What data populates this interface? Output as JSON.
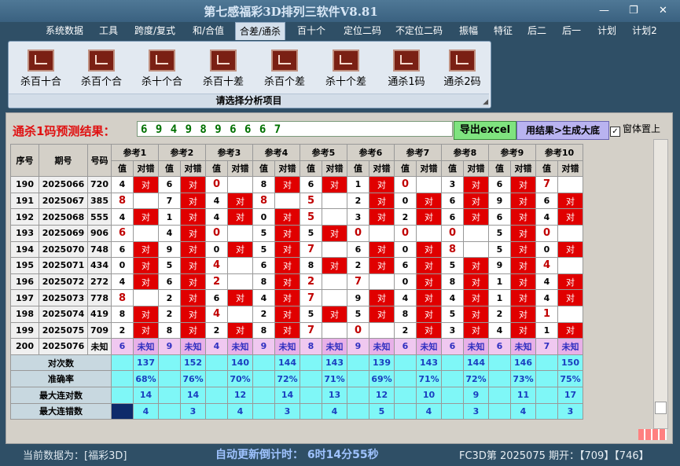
{
  "window": {
    "title": "第七感福彩3D排列三软件V8.81",
    "minimize": "—",
    "restore": "❐",
    "close": "✕"
  },
  "menu": [
    "系统数据",
    "工具",
    "跨度/复式",
    "和/合值",
    "合差/通杀",
    "百十个",
    "定位二码",
    "不定位二码",
    "振幅",
    "特征",
    "后二",
    "后一",
    "计划",
    "计划2"
  ],
  "menu_active": "合差/通杀",
  "ribbon": {
    "buttons": [
      {
        "label": "杀百十合",
        "icon": "chart-icon"
      },
      {
        "label": "杀百个合",
        "icon": "chart-icon"
      },
      {
        "label": "杀十个合",
        "icon": "chart-icon"
      },
      {
        "label": "杀百十差",
        "icon": "chart-icon"
      },
      {
        "label": "杀百个差",
        "icon": "chart-icon"
      },
      {
        "label": "杀十个差",
        "icon": "chart-icon"
      },
      {
        "label": "通杀1码",
        "icon": "chart-icon"
      },
      {
        "label": "通杀2码",
        "icon": "chart-icon"
      }
    ],
    "caption": "请选择分析项目"
  },
  "prediction": {
    "label": "通杀1码预测结果：",
    "value": "6 9 4 9 8 9 6 6 6 7",
    "export_label": "导出excel",
    "generate_label": "用结果>生成大底",
    "topmost_label": "窗体置上",
    "topmost_checked": "✓"
  },
  "table": {
    "h_seq": "序号",
    "h_period": "期号",
    "h_code": "号码",
    "refs": [
      "参考1",
      "参考2",
      "参考3",
      "参考4",
      "参考5",
      "参考6",
      "参考7",
      "参考8",
      "参考9",
      "参考10"
    ],
    "sub_val": "值",
    "sub_res": "对错",
    "hit_text": "对",
    "rows": [
      {
        "seq": "190",
        "period": "2025066",
        "code": "720",
        "cells": [
          [
            "4",
            1
          ],
          [
            "6",
            1
          ],
          [
            "0",
            0
          ],
          [
            "8",
            1
          ],
          [
            "6",
            1
          ],
          [
            "1",
            1
          ],
          [
            "0",
            0
          ],
          [
            "3",
            1
          ],
          [
            "6",
            1
          ],
          [
            "7",
            0
          ]
        ]
      },
      {
        "seq": "191",
        "period": "2025067",
        "code": "385",
        "cells": [
          [
            "8",
            0
          ],
          [
            "7",
            1
          ],
          [
            "4",
            1
          ],
          [
            "8",
            0
          ],
          [
            "5",
            0
          ],
          [
            "2",
            1
          ],
          [
            "0",
            1
          ],
          [
            "6",
            1
          ],
          [
            "9",
            1
          ],
          [
            "6",
            1
          ]
        ]
      },
      {
        "seq": "192",
        "period": "2025068",
        "code": "555",
        "cells": [
          [
            "4",
            1
          ],
          [
            "1",
            1
          ],
          [
            "4",
            1
          ],
          [
            "0",
            1
          ],
          [
            "5",
            0
          ],
          [
            "3",
            1
          ],
          [
            "2",
            1
          ],
          [
            "6",
            1
          ],
          [
            "6",
            1
          ],
          [
            "4",
            1
          ]
        ]
      },
      {
        "seq": "193",
        "period": "2025069",
        "code": "906",
        "cells": [
          [
            "6",
            0
          ],
          [
            "4",
            1
          ],
          [
            "0",
            0
          ],
          [
            "5",
            1
          ],
          [
            "5",
            1
          ],
          [
            "0",
            0
          ],
          [
            "0",
            0
          ],
          [
            "0",
            0
          ],
          [
            "5",
            1
          ],
          [
            "0",
            0
          ]
        ]
      },
      {
        "seq": "194",
        "period": "2025070",
        "code": "748",
        "cells": [
          [
            "6",
            1
          ],
          [
            "9",
            1
          ],
          [
            "0",
            1
          ],
          [
            "5",
            1
          ],
          [
            "7",
            0
          ],
          [
            "6",
            1
          ],
          [
            "0",
            1
          ],
          [
            "8",
            0
          ],
          [
            "5",
            1
          ],
          [
            "0",
            1
          ]
        ]
      },
      {
        "seq": "195",
        "period": "2025071",
        "code": "434",
        "cells": [
          [
            "0",
            1
          ],
          [
            "5",
            1
          ],
          [
            "4",
            0
          ],
          [
            "6",
            1
          ],
          [
            "8",
            1
          ],
          [
            "2",
            1
          ],
          [
            "6",
            1
          ],
          [
            "5",
            1
          ],
          [
            "9",
            1
          ],
          [
            "4",
            0
          ]
        ]
      },
      {
        "seq": "196",
        "period": "2025072",
        "code": "272",
        "cells": [
          [
            "4",
            1
          ],
          [
            "6",
            1
          ],
          [
            "2",
            0
          ],
          [
            "8",
            1
          ],
          [
            "2",
            0
          ],
          [
            "7",
            0
          ],
          [
            "0",
            1
          ],
          [
            "8",
            1
          ],
          [
            "1",
            1
          ],
          [
            "4",
            1
          ]
        ]
      },
      {
        "seq": "197",
        "period": "2025073",
        "code": "778",
        "cells": [
          [
            "8",
            0
          ],
          [
            "2",
            1
          ],
          [
            "6",
            1
          ],
          [
            "4",
            1
          ],
          [
            "7",
            0
          ],
          [
            "9",
            1
          ],
          [
            "4",
            1
          ],
          [
            "4",
            1
          ],
          [
            "1",
            1
          ],
          [
            "4",
            1
          ]
        ]
      },
      {
        "seq": "198",
        "period": "2025074",
        "code": "419",
        "cells": [
          [
            "8",
            1
          ],
          [
            "2",
            1
          ],
          [
            "4",
            0
          ],
          [
            "2",
            1
          ],
          [
            "5",
            1
          ],
          [
            "5",
            1
          ],
          [
            "8",
            1
          ],
          [
            "5",
            1
          ],
          [
            "2",
            1
          ],
          [
            "1",
            0
          ]
        ]
      },
      {
        "seq": "199",
        "period": "2025075",
        "code": "709",
        "cells": [
          [
            "2",
            1
          ],
          [
            "8",
            1
          ],
          [
            "2",
            1
          ],
          [
            "8",
            1
          ],
          [
            "7",
            0
          ],
          [
            "0",
            0
          ],
          [
            "2",
            1
          ],
          [
            "3",
            1
          ],
          [
            "4",
            1
          ],
          [
            "1",
            1
          ]
        ]
      }
    ],
    "unknown_row": {
      "seq": "200",
      "period": "2025076",
      "code": "未知",
      "vals": [
        "6",
        "9",
        "4",
        "9",
        "8",
        "9",
        "6",
        "6",
        "6",
        "7"
      ],
      "res": "未知"
    },
    "stats": [
      {
        "label": "对次数",
        "vals": [
          "137",
          "152",
          "140",
          "144",
          "143",
          "139",
          "143",
          "144",
          "146",
          "150"
        ]
      },
      {
        "label": "准确率",
        "vals": [
          "68%",
          "76%",
          "70%",
          "72%",
          "71%",
          "69%",
          "71%",
          "72%",
          "73%",
          "75%"
        ]
      },
      {
        "label": "最大连对数",
        "vals": [
          "14",
          "14",
          "12",
          "14",
          "13",
          "12",
          "10",
          "9",
          "11",
          "17"
        ]
      },
      {
        "label": "最大连错数",
        "vals": [
          "4",
          "3",
          "4",
          "3",
          "4",
          "5",
          "4",
          "3",
          "4",
          "3"
        ]
      }
    ]
  },
  "status": {
    "source": "当前数据为：[福彩3D]",
    "countdown": "自动更新倒计时： 6时14分55秒",
    "draw": "FC3D第 2025075 期开：【709】【746】"
  }
}
